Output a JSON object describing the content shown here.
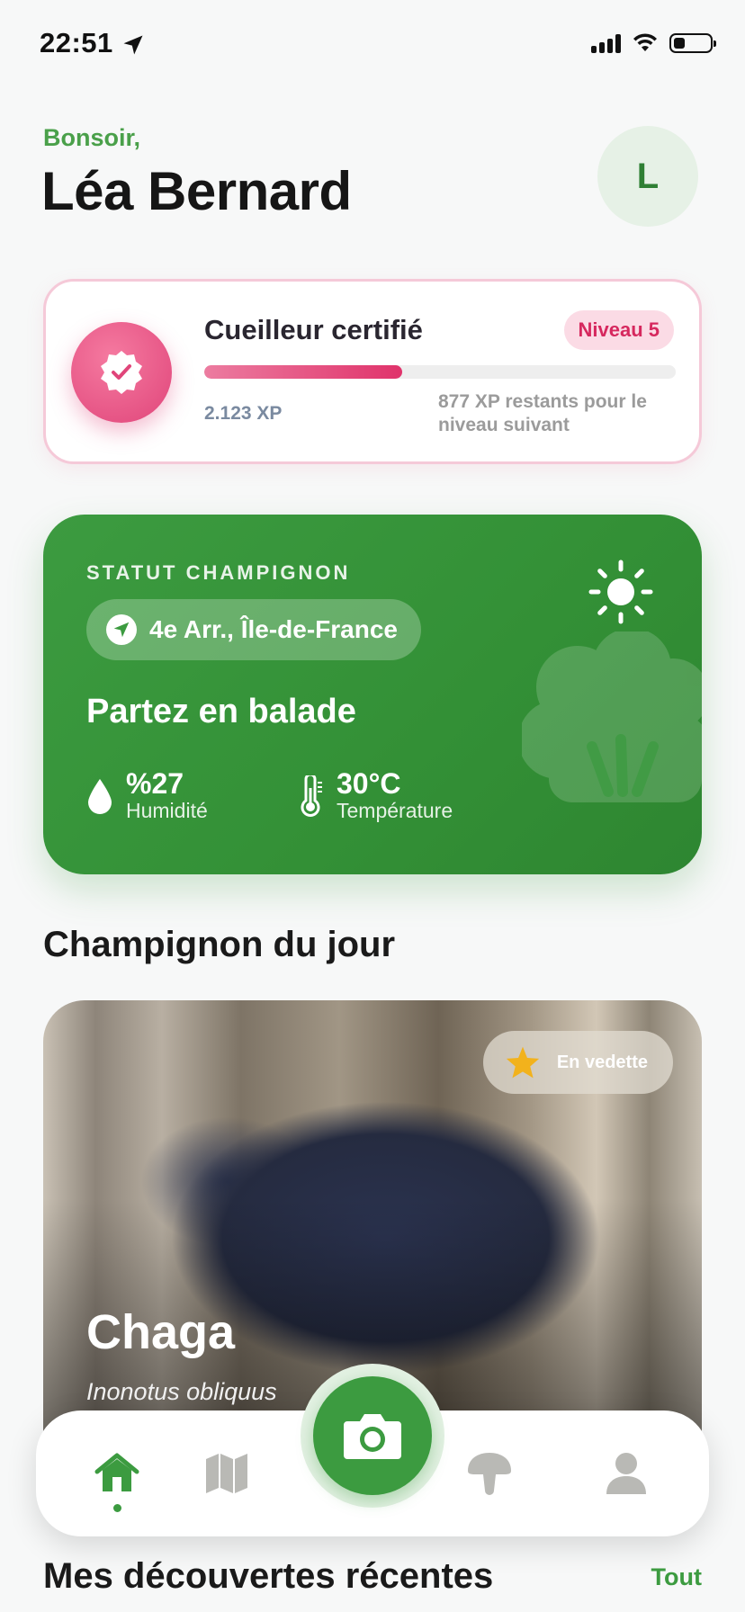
{
  "status_bar": {
    "time": "22:51",
    "battery_level": 0.3
  },
  "header": {
    "greeting": "Bonsoir,",
    "user_name": "Léa Bernard",
    "avatar_initial": "L"
  },
  "level_card": {
    "title": "Cueilleur certifié",
    "level": "Niveau 5",
    "xp": "2.123 XP",
    "remaining": "877 XP restants pour le niveau suivant",
    "progress": 0.42,
    "accent": "#e0457a"
  },
  "mushroom_status": {
    "label": "STATUT CHAMPIGNON",
    "location": "4e Arr., Île-de-France",
    "message": "Partez en balade",
    "humidity_value": "%27",
    "humidity_label": "Humidité",
    "temperature_value": "30°C",
    "temperature_label": "Température",
    "weather_icon": "sun-icon",
    "accent": "#3c9b40"
  },
  "daily": {
    "section_title": "Champignon du jour",
    "badge": "En vedette",
    "name": "Chaga",
    "latin": "Inonotus obliquus"
  },
  "nav": {
    "items": [
      "home-icon",
      "map-icon",
      "camera-icon",
      "mushroom-icon",
      "profile-icon"
    ],
    "active": "home"
  },
  "recent": {
    "title": "Mes découvertes récentes",
    "see_all": "Tout"
  }
}
